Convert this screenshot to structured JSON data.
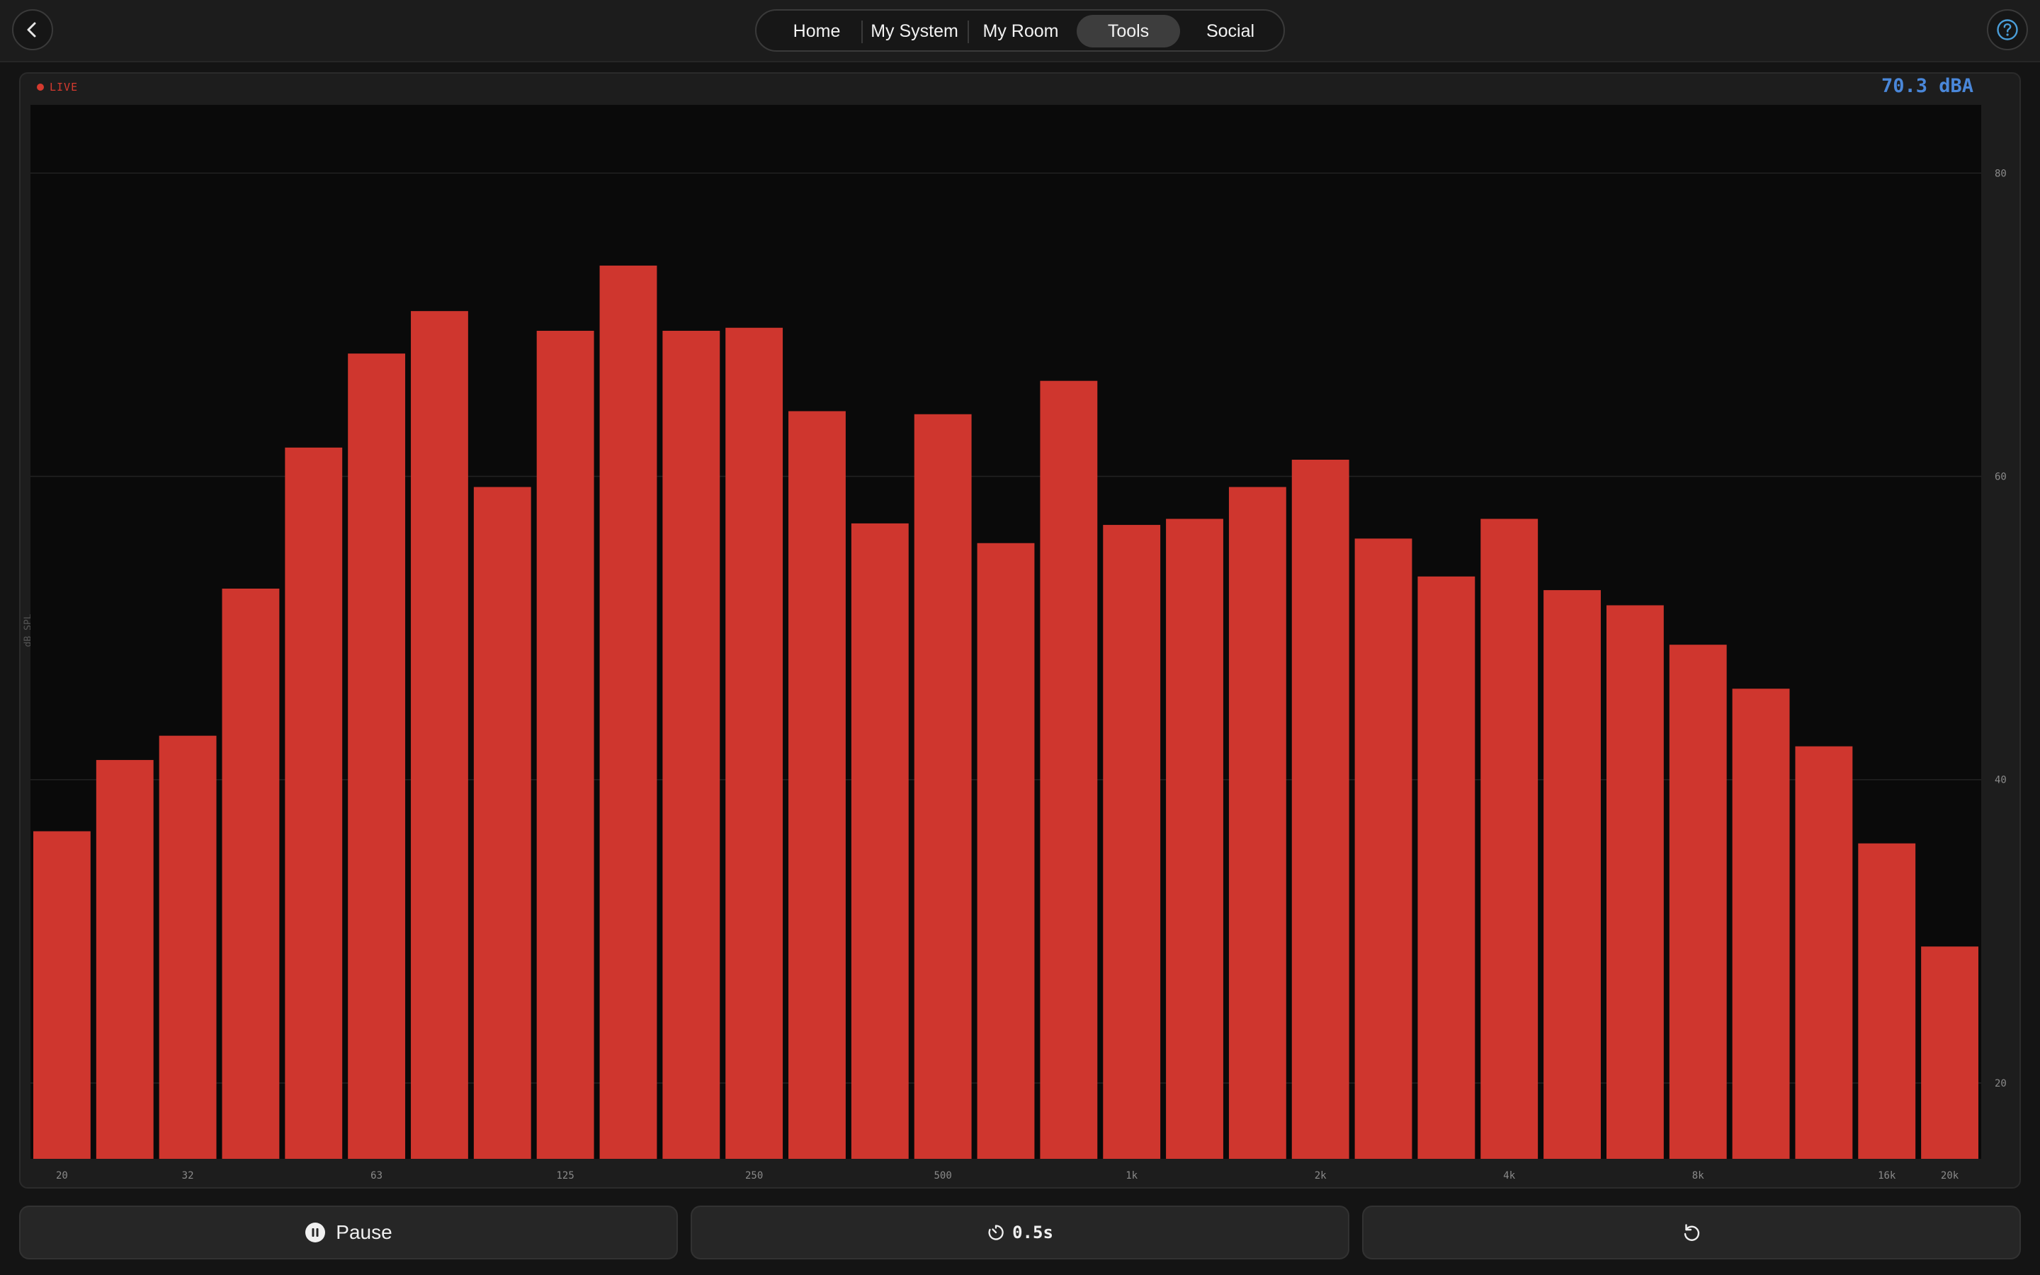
{
  "nav": {
    "items": [
      "Home",
      "My System",
      "My Room",
      "Tools",
      "Social"
    ],
    "active_index": 3
  },
  "icons": {
    "back": "chevron-left-icon",
    "help": "help-circle-icon",
    "pause": "pause-circle-icon",
    "timer": "timer-icon",
    "reset": "reset-icon"
  },
  "meter": {
    "live_label": "LIVE",
    "level_readout": "70.3 dBA"
  },
  "colors": {
    "bar": "#cf362e",
    "live": "#d53a2f",
    "readout": "#4a87d9",
    "plot_bg": "#0a0a0a"
  },
  "chart_data": {
    "type": "bar",
    "ylabel": "dB SPL",
    "ylim": [
      15,
      84.5
    ],
    "yticks": [
      20,
      40,
      60,
      80
    ],
    "grid": true,
    "x_tick_labels": [
      {
        "band": 0,
        "label": "20"
      },
      {
        "band": 2,
        "label": "32"
      },
      {
        "band": 5,
        "label": "63"
      },
      {
        "band": 8,
        "label": "125"
      },
      {
        "band": 11,
        "label": "250"
      },
      {
        "band": 14,
        "label": "500"
      },
      {
        "band": 17,
        "label": "1k"
      },
      {
        "band": 20,
        "label": "2k"
      },
      {
        "band": 23,
        "label": "4k"
      },
      {
        "band": 26,
        "label": "8k"
      },
      {
        "band": 29,
        "label": "16k"
      },
      {
        "band": 30,
        "label": "20k"
      }
    ],
    "categories": [
      "20",
      "25",
      "32",
      "40",
      "50",
      "63",
      "80",
      "100",
      "125",
      "160",
      "200",
      "250",
      "315",
      "400",
      "500",
      "630",
      "800",
      "1k",
      "1.25k",
      "1.6k",
      "2k",
      "2.5k",
      "3.15k",
      "4k",
      "5k",
      "6.3k",
      "8k",
      "10k",
      "12.5k",
      "16k",
      "20k"
    ],
    "values": [
      36.6,
      41.3,
      42.9,
      52.6,
      61.9,
      68.1,
      70.9,
      59.3,
      69.6,
      73.9,
      69.6,
      69.8,
      64.3,
      56.9,
      64.1,
      55.6,
      66.3,
      56.8,
      57.2,
      59.3,
      61.1,
      55.9,
      53.4,
      57.2,
      52.5,
      51.5,
      48.9,
      46.0,
      42.2,
      35.8,
      29.0
    ]
  },
  "controls": {
    "pause_label": "Pause",
    "interval_label": "0.5s"
  }
}
